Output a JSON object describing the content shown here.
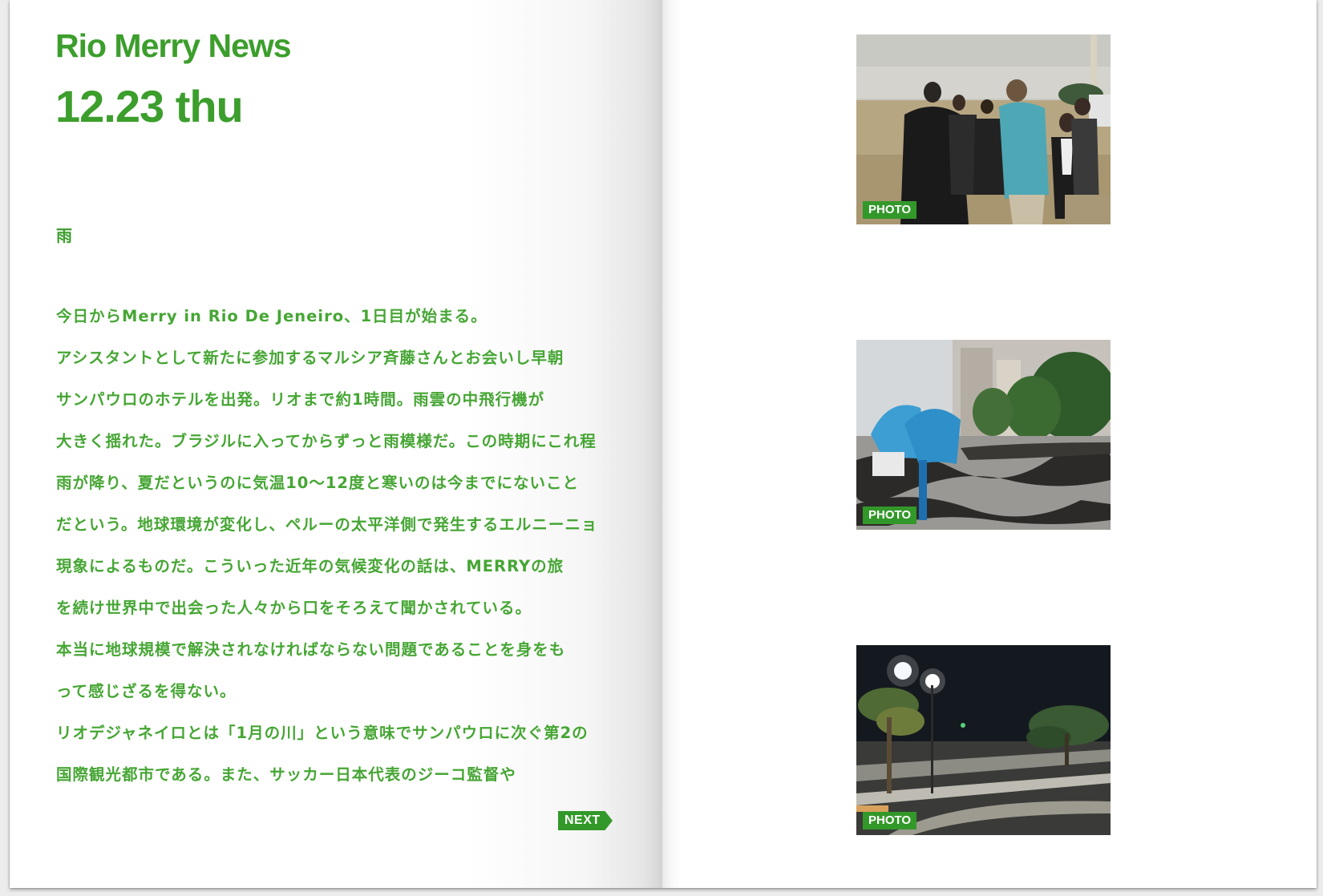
{
  "header": {
    "title": "Rio Merry News",
    "date": "12.23 thu"
  },
  "weather": "雨",
  "article_lines": [
    "今日からMerry in Rio De Jeneiro、1日目が始まる。",
    "アシスタントとして新たに参加するマルシア斉藤さんとお会いし早朝",
    "サンパウロのホテルを出発。リオまで約1時間。雨雲の中飛行機が",
    "大きく揺れた。ブラジルに入ってからずっと雨模様だ。この時期にこれ程",
    "雨が降り、夏だというのに気温10〜12度と寒いのは今までにないこと",
    "だという。地球環境が変化し、ペルーの太平洋側で発生するエルニーニョ",
    "現象によるものだ。こういった近年の気候変化の話は、MERRYの旅",
    "を続け世界中で出会った人々から口をそろえて聞かされている。",
    "本当に地球規模で解決されなければならない問題であることを身をも",
    "って感じざるを得ない。",
    "リオデジャネイロとは「1月の川」という意味でサンパウロに次ぐ第2の",
    "国際観光都市である。また、サッカー日本代表のジーコ監督や"
  ],
  "next_label": "NEXT",
  "photos": [
    {
      "label": "PHOTO",
      "scene": "people-on-beach"
    },
    {
      "label": "PHOTO",
      "scene": "phone-booth-promenade"
    },
    {
      "label": "PHOTO",
      "scene": "night-street-palms"
    }
  ],
  "colors": {
    "accent": "#3c9e2c",
    "label_bg": "#33982a"
  }
}
